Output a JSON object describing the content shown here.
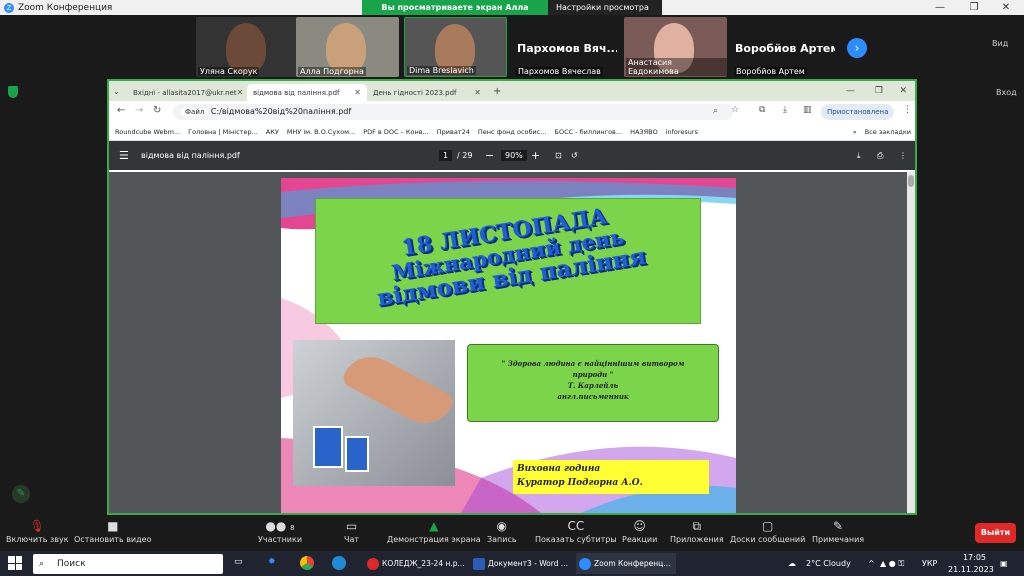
{
  "titlebar": {
    "app_title": "Zoom Конференция"
  },
  "share_banner": {
    "viewing_text": "Вы просматриваете экран Алла Подгорна",
    "view_settings": "Настройки просмотра"
  },
  "gallery": {
    "participants": [
      {
        "name": "Уляна Скорук"
      },
      {
        "name": "Алла Подгорна"
      },
      {
        "name": "Dima Breslavich"
      },
      {
        "name": "Пархомов Вячеслав",
        "display": "Пархомов Вяч..."
      },
      {
        "name": "Анастасия Евдокимова"
      },
      {
        "name": "Воробйов Артем",
        "display": "Воробйов Артем"
      }
    ],
    "view_label": "Вид",
    "exit_fullscreen": "Вход"
  },
  "browser": {
    "tabs": [
      {
        "label": "Вхідні - allasita2017@ukr.net"
      },
      {
        "label": "відмова від паління.pdf"
      },
      {
        "label": "День гідності 2023.pdf"
      }
    ],
    "url_prefix": "Файл",
    "url": "C:/відмова%20від%20паління.pdf",
    "profile_label": "Приостановлена",
    "bookmarks": [
      "Roundcube Webm...",
      "Головна | Міністер...",
      "АКУ",
      "МНУ ім. В.О.Сухом...",
      "PDF в DOC – Конв...",
      "Приват24",
      "Пенс фонд особис...",
      "БОСС - биллингов...",
      "НАЗЯВО",
      "inforesurs"
    ],
    "all_bookmarks": "Все закладки"
  },
  "pdf": {
    "filename": "відмова від паління.pdf",
    "page_current": "1",
    "page_total": "/ 29",
    "zoom": "90%",
    "slide": {
      "title_line1": "18 ЛИСТОПАДА",
      "title_line2": "Міжнародний день",
      "title_line3": "відмови від паління",
      "quote_line1": "\" Здорова людина є найціннішим витвором",
      "quote_line2": "природи \"",
      "quote_author": "Т. Карлейль",
      "quote_role": "англ.письменник",
      "footer_line1": "Виховна година",
      "footer_line2": "Куратор Подгорна А.О."
    }
  },
  "controls": {
    "mute": "Включить звук",
    "video": "Остановить видео",
    "participants": "Участники",
    "participants_count": "8",
    "chat": "Чат",
    "share": "Демонстрация экрана",
    "record": "Запись",
    "subtitles": "Показать субтитры",
    "reactions": "Реакции",
    "apps": "Приложения",
    "whiteboards": "Доски сообщений",
    "notes": "Примечания",
    "leave": "Выйти"
  },
  "taskbar": {
    "search": "Поиск",
    "apps": [
      "КОЛЕДЖ_23-24 н.р...",
      "Документ3 - Word ...",
      "Zoom Конференц..."
    ],
    "weather": "2°C  Cloudy",
    "lang": "УКР",
    "time": "17:05",
    "date": "21.11.2023"
  },
  "colors": {
    "zoom_blue": "#2d8cff",
    "share_green": "#19a34a",
    "leave_red": "#e02828",
    "slide_green": "#7bd44a",
    "slide_title_blue": "#1f5fd6"
  }
}
